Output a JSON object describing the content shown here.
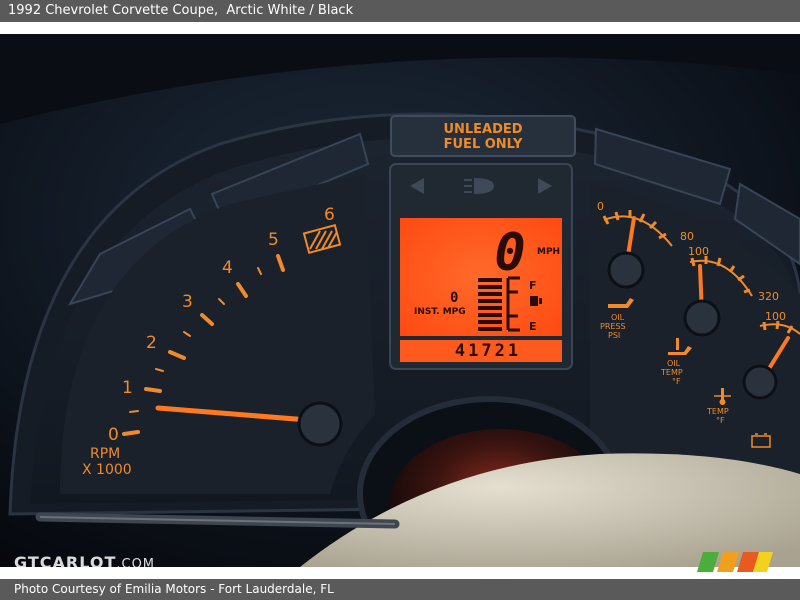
{
  "header": {
    "title": "1992 Chevrolet Corvette Coupe,",
    "subtitle": "Arctic White / Black"
  },
  "footer": {
    "credit": "Photo Courtesy of Emilia Motors - Fort Lauderdale, FL"
  },
  "watermark": {
    "brand": "GTCARLOT",
    "suffix": ".COM"
  },
  "dashboard": {
    "warning_label_line1": "UNLEADED",
    "warning_label_line2": "FUEL ONLY",
    "tachometer": {
      "ticks": [
        "0",
        "1",
        "2",
        "3",
        "4",
        "5",
        "6"
      ],
      "unit_line1": "RPM",
      "unit_line2": "X 1000",
      "needle_rpm": 0.4
    },
    "digital": {
      "speed": "0",
      "speed_unit": "MPH",
      "mpg_label": "INST. MPG",
      "mpg_value": "0",
      "fuel_full": "F",
      "fuel_empty": "E",
      "odometer": "41721"
    },
    "gauges": {
      "oil_press": {
        "min": "0",
        "max": "80",
        "label_line1": "OIL",
        "label_line2": "PRESS",
        "label_line3": "PSI"
      },
      "oil_temp": {
        "min": "100",
        "max": "320",
        "label_line1": "OIL",
        "label_line2": "TEMP",
        "label_line3": "°F"
      },
      "coolant_temp": {
        "min": "100",
        "label_line1": "TEMP",
        "label_line2": "°F"
      }
    },
    "icons": [
      "left-turn-signal-icon",
      "headlight-icon",
      "right-turn-signal-icon",
      "rear-defrost-icon",
      "fuel-pump-icon",
      "oil-can-icon",
      "thermometer-icon",
      "battery-icon"
    ]
  },
  "colors": {
    "amber": "#f08a2a",
    "lcd": "#ff5a1e",
    "bar": "#5a5a5a"
  }
}
